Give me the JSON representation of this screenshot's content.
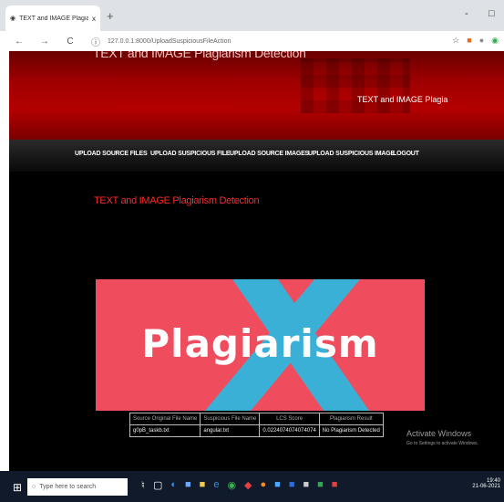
{
  "browser": {
    "tab_title": "TEXT and IMAGE Plagiarism Dete",
    "tab_close": "x",
    "new_tab": "+",
    "url": "127.0.0.1:8000/UploadSuspiciousFileAction",
    "win_min": "-",
    "win_max": "□"
  },
  "banner": {
    "title": "TEXT and IMAGE Plagiarism Detection",
    "subtitle": "TEXT and IMAGE Plagia"
  },
  "menu": [
    "UPLOAD SOURCE FILES",
    "UPLOAD SUSPICIOUS FILE",
    "UPLOAD SOURCE IMAGES",
    "UPLOAD SUSPICIOUS IMAGE",
    "LOGOUT"
  ],
  "content": {
    "title": "TEXT and IMAGE Plagiarism Detection",
    "image_word": "Plagiarism"
  },
  "table": {
    "headers": [
      "Source Original File Name",
      "Suspicious File Name",
      "LCS Score",
      "Plagiarism Result"
    ],
    "rows": [
      [
        "g0pB_taskb.txt",
        "angular.txt",
        "0.0224074074074074",
        "No Plagiarism Detected"
      ]
    ]
  },
  "watermark": {
    "line1": "Activate Windows",
    "line2": "Go to Settings to activate Windows."
  },
  "taskbar": {
    "search_placeholder": "Type here to search",
    "time": "19:40",
    "date": "21-06-2021"
  },
  "colors": {
    "banner_red": "#b30000",
    "title_red": "#ff2a2a",
    "image_pink": "#ef4d5d",
    "cross_blue": "#3bb0d6"
  }
}
